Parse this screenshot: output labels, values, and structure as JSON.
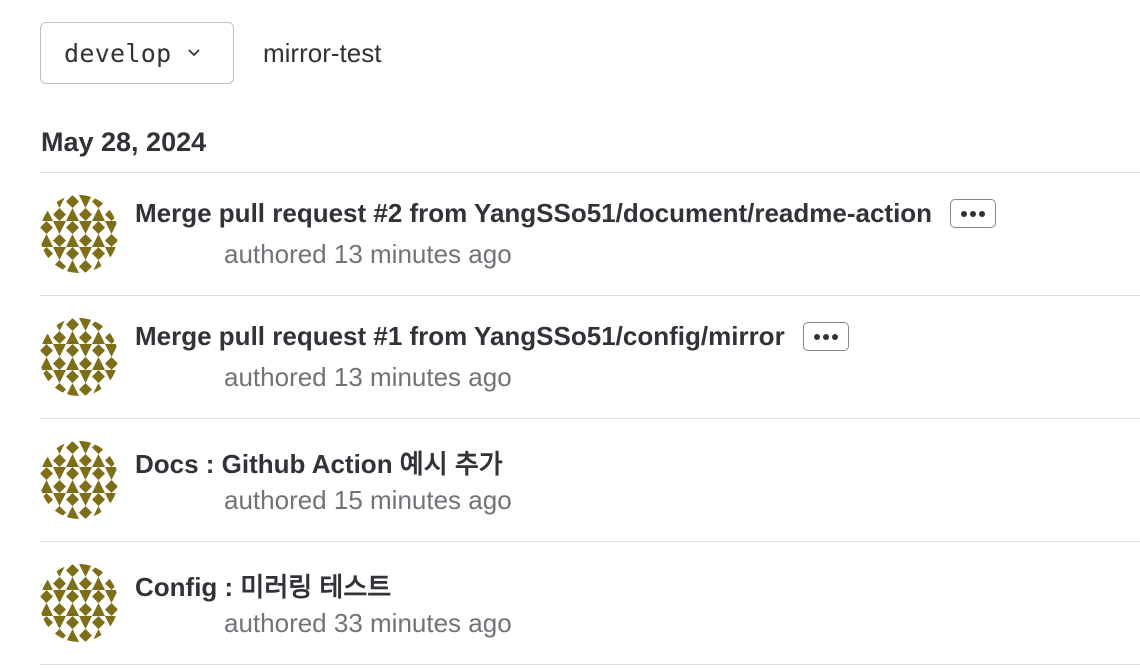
{
  "branch_selector": {
    "current_branch": "develop",
    "icon": "chevron-down-icon"
  },
  "repository": {
    "path": "mirror-test"
  },
  "commit_group": {
    "date": "May 28, 2024"
  },
  "commits": [
    {
      "title": "Merge pull request #2 from YangSSo51/document/readme-action",
      "meta": "authored 13 minutes ago",
      "has_expand_button": true
    },
    {
      "title": "Merge pull request #1 from YangSSo51/config/mirror",
      "meta": "authored 13 minutes ago",
      "has_expand_button": true
    },
    {
      "title": "Docs : Github Action 예시 추가",
      "meta": "authored 15 minutes ago",
      "has_expand_button": false
    },
    {
      "title": "Config : 미러링 테스트",
      "meta": "authored 33 minutes ago",
      "has_expand_button": false
    }
  ],
  "colors": {
    "avatar_olive": "#7d6e17",
    "text_primary": "#333238",
    "text_secondary": "#737278",
    "divider": "#dcdcde"
  }
}
